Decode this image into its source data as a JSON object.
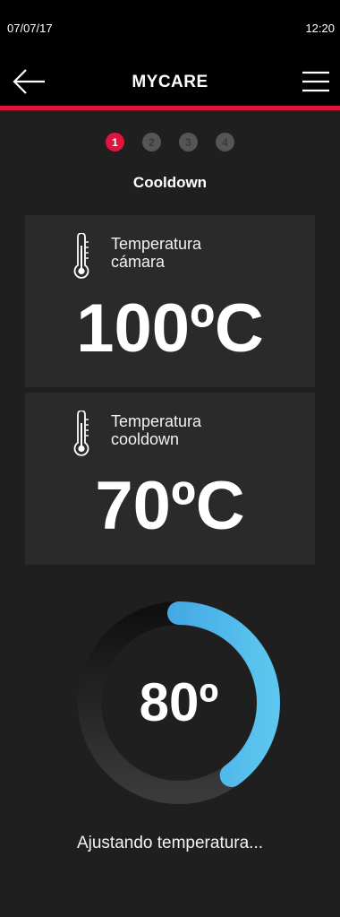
{
  "statusbar": {
    "date": "07/07/17",
    "time": "12:20"
  },
  "header": {
    "title": "MYCARE"
  },
  "steps": [
    "1",
    "2",
    "3",
    "4"
  ],
  "stage": {
    "title": "Cooldown"
  },
  "cards": [
    {
      "label_line1": "Temperatura",
      "label_line2": "cámara",
      "value": "100ºC"
    },
    {
      "label_line1": "Temperatura",
      "label_line2": "cooldown",
      "value": "70ºC"
    }
  ],
  "dial": {
    "value": "80º",
    "progress_fraction": 0.4
  },
  "status_message": "Ajustando temperatura...",
  "colors": {
    "accent": "#e0153f",
    "progress": "#3aa0e6",
    "background": "#1f1f1f"
  },
  "icons": {
    "back": "back-arrow-icon",
    "menu": "hamburger-menu-icon",
    "thermometer": "thermometer-icon"
  }
}
